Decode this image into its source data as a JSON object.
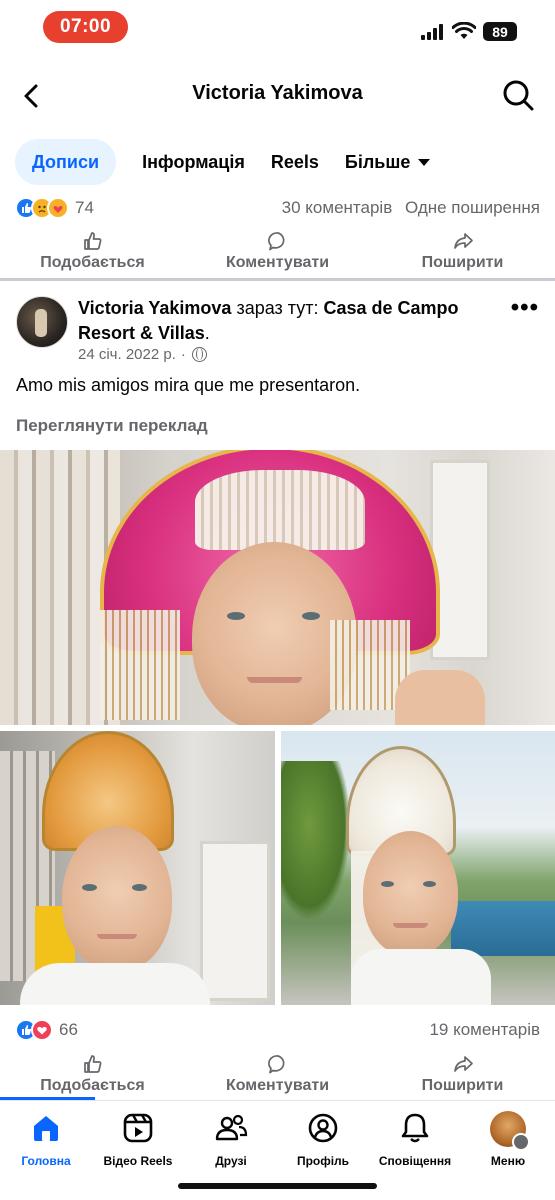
{
  "status_bar": {
    "time": "07:00",
    "battery": "89"
  },
  "header": {
    "title": "Victoria Yakimova"
  },
  "tabs": [
    {
      "label": "Дописи"
    },
    {
      "label": "Інформація"
    },
    {
      "label": "Reels"
    },
    {
      "label": "Більше"
    }
  ],
  "prev_post": {
    "reaction_count": "74",
    "comments": "30 коментарів",
    "shares": "Одне поширення"
  },
  "actions": {
    "like": "Подобається",
    "comment": "Коментувати",
    "share": "Поширити"
  },
  "post": {
    "author": "Victoria Yakimova",
    "location_prefix": "зараз тут:",
    "location": "Casa de Campo Resort & Villas",
    "location_suffix": ".",
    "date": "24 січ. 2022 р.",
    "dot": "·",
    "text": "Amo mis amigos mira que me presentaron.",
    "translate": "Переглянути переклад",
    "reaction_count": "66",
    "comments": "19 коментарів",
    "more": "•••"
  },
  "bottom_nav": [
    {
      "label": "Головна",
      "icon": "home-icon"
    },
    {
      "label": "Відео Reels",
      "icon": "reels-icon"
    },
    {
      "label": "Друзі",
      "icon": "friends-icon"
    },
    {
      "label": "Профіль",
      "icon": "profile-icon"
    },
    {
      "label": "Сповіщення",
      "icon": "bell-icon"
    },
    {
      "label": "Меню",
      "icon": "menu-avatar"
    }
  ],
  "colors": {
    "accent": "#0866ff",
    "status_pill": "#e8402f",
    "muted": "#65676b"
  }
}
